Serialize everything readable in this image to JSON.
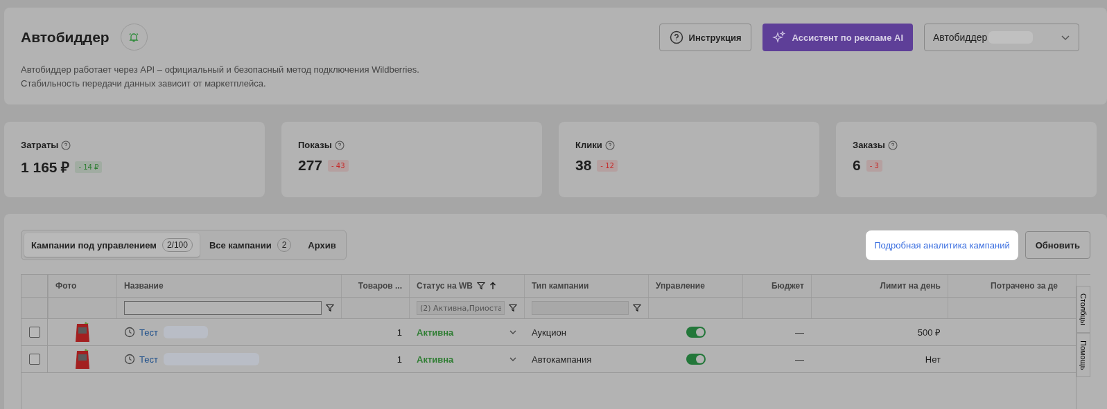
{
  "header": {
    "title": "Автобиддер",
    "description": [
      "Автобиддер работает через API – официальный и безопасный метод подключения Wildberries.",
      "Стабильность передачи данных зависит от маркетплейса."
    ],
    "help_button": "Инструкция",
    "ai_button": "Ассистент по рекламе AI",
    "account_select": {
      "value": "Автобиддер"
    }
  },
  "stats": [
    {
      "label": "Затраты",
      "value": "1 165 ₽",
      "delta": {
        "text": "- 14 ₽",
        "color": "#2e7d32"
      }
    },
    {
      "label": "Показы",
      "value": "277",
      "delta": {
        "text": "- 43",
        "color": "#c62828"
      }
    },
    {
      "label": "Клики",
      "value": "38",
      "delta": {
        "text": "- 12",
        "color": "#c62828"
      }
    },
    {
      "label": "Заказы",
      "value": "6",
      "delta": {
        "text": "- 3",
        "color": "#c62828"
      }
    }
  ],
  "tabs": [
    {
      "label": "Кампании под управлением",
      "count": "2/100",
      "selected": true
    },
    {
      "label": "Все кампании",
      "count": "2",
      "selected": false
    },
    {
      "label": "Архив",
      "selected": false
    }
  ],
  "analytics_link": "Подробная аналитика кампаний",
  "refresh_button": "Обновить",
  "table": {
    "columns": [
      {
        "label": "Фото"
      },
      {
        "label": "Название"
      },
      {
        "label": "Товаров ..."
      },
      {
        "label": "Статус на WB",
        "filter": true,
        "sorted": true
      },
      {
        "label": "Тип кампании"
      },
      {
        "label": "Управление"
      },
      {
        "label": "Бюджет"
      },
      {
        "label": "Лимит на день"
      },
      {
        "label": "Потрачено за де"
      }
    ],
    "filters": {
      "status": {
        "value": "(2) Активна,Приоста"
      }
    },
    "rows": [
      {
        "checked": false,
        "name": "Тест",
        "count": "1",
        "status": "Активна",
        "type": "Аукцион",
        "managed": true,
        "budget": "—",
        "limit": "500 ₽"
      },
      {
        "checked": false,
        "name": "Тест",
        "count": "1",
        "status": "Активна",
        "type": "Автокампания",
        "managed": true,
        "budget": "—",
        "limit": "Нет"
      }
    ]
  },
  "side_tabs": [
    "Столбцы",
    "Помощь"
  ]
}
